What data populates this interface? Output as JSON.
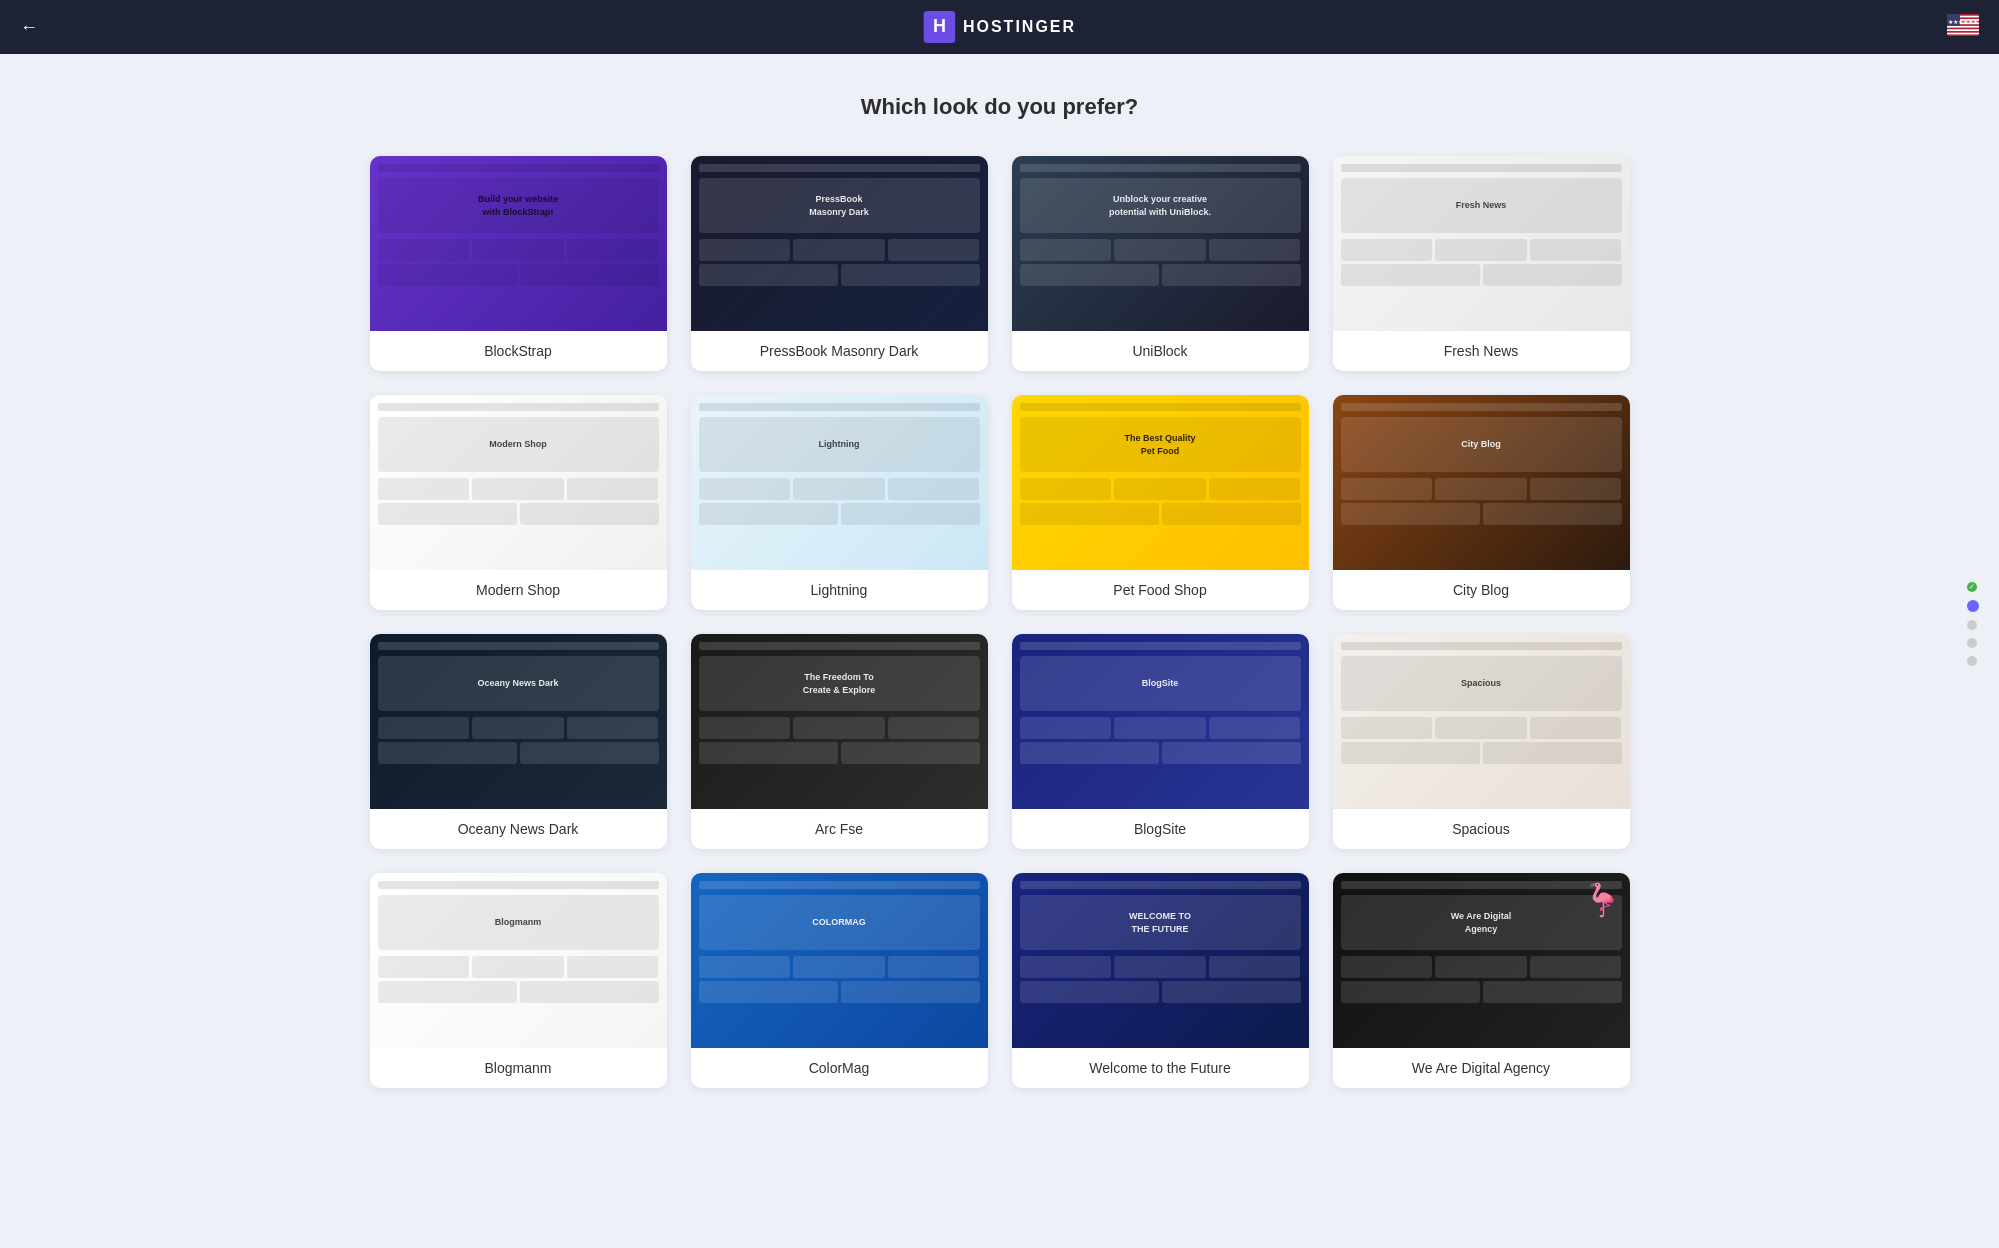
{
  "header": {
    "back_label": "←",
    "brand": "HOSTINGER",
    "logo_symbol": "H"
  },
  "page": {
    "title": "Which look do you prefer?"
  },
  "themes": [
    {
      "id": "blockstrap",
      "name": "BlockStrap",
      "preview_class": "preview-blockstrap",
      "hero_text": "Build your website\nwith BlockStrap!",
      "dark": false
    },
    {
      "id": "pressbook-masonry-dark",
      "name": "PressBook Masonry Dark",
      "preview_class": "preview-pressbook",
      "hero_text": "PressBook\nMasonry Dark",
      "dark": true
    },
    {
      "id": "uniblock",
      "name": "UniBlock",
      "preview_class": "preview-uniblock",
      "hero_text": "Unblock your creative\npotential with UniBlock.",
      "dark": true
    },
    {
      "id": "fresh-news",
      "name": "Fresh News",
      "preview_class": "preview-freshnews",
      "hero_text": "Fresh News",
      "dark": false
    },
    {
      "id": "modern-shop",
      "name": "Modern Shop",
      "preview_class": "preview-modernshop",
      "hero_text": "Modern Shop",
      "dark": false
    },
    {
      "id": "lightning",
      "name": "Lightning",
      "preview_class": "preview-lightning",
      "hero_text": "Lightning",
      "dark": false
    },
    {
      "id": "pet-food-shop",
      "name": "Pet Food Shop",
      "preview_class": "preview-petfood",
      "hero_text": "The Best Quality\nPet Food",
      "dark": false
    },
    {
      "id": "city-blog",
      "name": "City Blog",
      "preview_class": "preview-cityblog",
      "hero_text": "City Blog",
      "dark": true
    },
    {
      "id": "oceany-news-dark",
      "name": "Oceany News Dark",
      "preview_class": "preview-oceanlydark",
      "hero_text": "Oceany News Dark",
      "dark": true
    },
    {
      "id": "arc-fse",
      "name": "Arc Fse",
      "preview_class": "preview-arcfse",
      "hero_text": "The Freedom To\nCreate & Explore",
      "dark": true
    },
    {
      "id": "blogsite",
      "name": "BlogSite",
      "preview_class": "preview-blogsite",
      "hero_text": "BlogSite",
      "dark": true
    },
    {
      "id": "spacious",
      "name": "Spacious",
      "preview_class": "preview-spacious",
      "hero_text": "Spacious",
      "dark": false
    },
    {
      "id": "blogmanm",
      "name": "Blogmanm",
      "preview_class": "preview-blogmanm",
      "hero_text": "Blogmanm",
      "dark": false
    },
    {
      "id": "colormag",
      "name": "ColorMag",
      "preview_class": "preview-colormag",
      "hero_text": "COLORMAG",
      "dark": true
    },
    {
      "id": "welcome-future",
      "name": "Welcome to the Future",
      "preview_class": "preview-welcomefuture",
      "hero_text": "WELCOME TO\nTHE FUTURE",
      "dark": true
    },
    {
      "id": "we-are-digital-agency",
      "name": "We Are Digital Agency",
      "preview_class": "preview-weAredigital",
      "hero_text": "We Are Digital\nAgency",
      "dark": true
    }
  ],
  "scroll_dots": [
    {
      "state": "check"
    },
    {
      "state": "active"
    },
    {
      "state": "inactive"
    },
    {
      "state": "inactive"
    },
    {
      "state": "inactive"
    }
  ]
}
